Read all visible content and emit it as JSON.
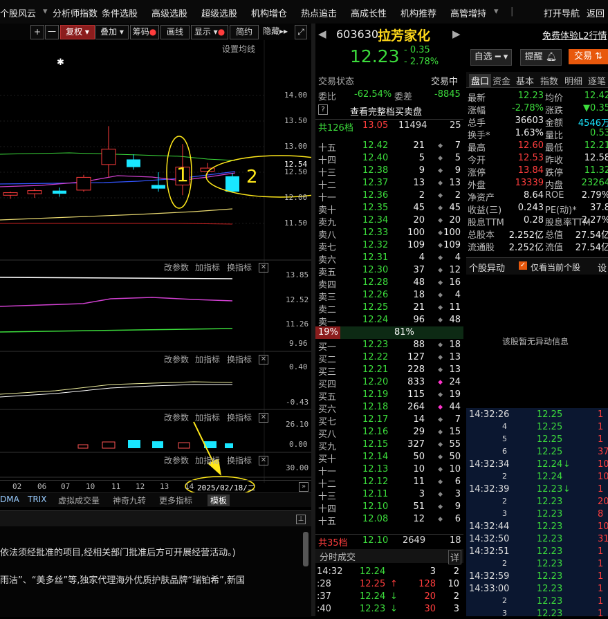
{
  "top_menu": {
    "items": [
      "个股风云",
      "分析师指数",
      "条件选股",
      "高级选股",
      "超级选股",
      "机构增仓",
      "热点追击",
      "高成长性",
      "机构推荐",
      "高管增持"
    ],
    "right_items": [
      "打开导航",
      "返回"
    ]
  },
  "toolbar": {
    "plus": "+",
    "minus": "一",
    "fuquan": "复权",
    "diejia": "叠加",
    "chouma": "筹码",
    "huaxian": "画线",
    "xianshi": "显示",
    "jianyue": "简约",
    "yincang": "隐藏",
    "ma_setting": "设置均线"
  },
  "kline": {
    "y_ticks": [
      "14.00",
      "13.50",
      "13.00",
      "12.54",
      "12.50",
      "12.00",
      "11.50"
    ],
    "annot1": "1",
    "annot2": "2",
    "star": "✱",
    "candles": [
      {
        "o": 12.05,
        "h": 12.12,
        "l": 11.98,
        "c": 12.1
      },
      {
        "o": 12.08,
        "h": 12.18,
        "l": 12.0,
        "c": 12.14
      },
      {
        "o": 12.14,
        "h": 12.2,
        "l": 12.02,
        "c": 12.08
      },
      {
        "o": 12.15,
        "h": 12.45,
        "l": 12.12,
        "c": 12.4
      },
      {
        "o": 12.65,
        "h": 13.4,
        "l": 12.4,
        "c": 12.95
      },
      {
        "o": 12.75,
        "h": 12.85,
        "l": 12.55,
        "c": 12.6
      },
      {
        "o": 12.25,
        "h": 12.5,
        "l": 12.12,
        "c": 12.18
      },
      {
        "o": 12.25,
        "h": 13.05,
        "l": 12.05,
        "c": 12.6
      },
      {
        "o": 12.52,
        "h": 12.68,
        "l": 12.45,
        "c": 12.58
      },
      {
        "o": 12.42,
        "h": 12.48,
        "l": 12.1,
        "c": 12.12
      }
    ]
  },
  "panel2": {
    "ctl": [
      "改参数",
      "加指标",
      "换指标"
    ],
    "y_ticks": [
      "13.85",
      "12.52",
      "11.26",
      "9.96"
    ]
  },
  "panel3": {
    "ctl": [
      "改参数",
      "加指标",
      "换指标"
    ],
    "y_ticks": [
      "0.40",
      "-0.43"
    ]
  },
  "panel4": {
    "ctl": [
      "改参数",
      "加指标",
      "换指标"
    ],
    "y_ticks": [
      "26.10",
      "0.00"
    ]
  },
  "panel5": {
    "ctl": [
      "改参数",
      "加指标",
      "换指标"
    ],
    "y_ticks": [
      "30.00"
    ]
  },
  "dates": [
    "02",
    "06",
    "07",
    "10",
    "11",
    "12",
    "13",
    "14"
  ],
  "date_box": "2025/02/18/二",
  "indicator_tabs": [
    "DMA",
    "TRIX",
    "虚拟成交量",
    "神奇九转",
    "更多指标",
    "模板"
  ],
  "bottom_text": [
    "依法须经批准的项目,经相关部门批准后方可开展经营活动。)",
    "雨洁”、“美多丝”等,独家代理海外优质护肤品牌“瑞铂希”,新国"
  ],
  "stock": {
    "code": "603630",
    "name": "拉芳家化",
    "price": "12.23",
    "change": "- 0.35",
    "pct": "- 2.78%",
    "free_l2": "免费体验L2行情",
    "zixuan": "自选",
    "tixing": "提醒",
    "jiaoyi": "交易"
  },
  "order_book": {
    "status_label": "交易状态",
    "status": "交易中",
    "weibi_label": "委比",
    "weibi": "-62.54%",
    "weicha_label": "委差",
    "weicha": "-8845",
    "full_book": "查看完整档买卖盘",
    "total_sell_label": "共126档",
    "total_sell_price": "13.05",
    "total_sell_vol": "11494",
    "total_sell_cnt": "25",
    "sells": [
      {
        "label": "十五",
        "price": "12.42",
        "vol": "21",
        "cnt": "7"
      },
      {
        "label": "十四",
        "price": "12.40",
        "vol": "5",
        "cnt": "5"
      },
      {
        "label": "十三",
        "price": "12.38",
        "vol": "9",
        "cnt": "9"
      },
      {
        "label": "十二",
        "price": "12.37",
        "vol": "13",
        "cnt": "13"
      },
      {
        "label": "十一",
        "price": "12.36",
        "vol": "2",
        "cnt": "2"
      },
      {
        "label": "卖十",
        "price": "12.35",
        "vol": "45",
        "cnt": "45"
      },
      {
        "label": "卖九",
        "price": "12.34",
        "vol": "20",
        "cnt": "20"
      },
      {
        "label": "卖八",
        "price": "12.33",
        "vol": "100",
        "cnt": "100"
      },
      {
        "label": "卖七",
        "price": "12.32",
        "vol": "109",
        "cnt": "109"
      },
      {
        "label": "卖六",
        "price": "12.31",
        "vol": "4",
        "cnt": "4"
      },
      {
        "label": "卖五",
        "price": "12.30",
        "vol": "37",
        "cnt": "12"
      },
      {
        "label": "卖四",
        "price": "12.28",
        "vol": "48",
        "cnt": "16"
      },
      {
        "label": "卖三",
        "price": "12.26",
        "vol": "18",
        "cnt": "4"
      },
      {
        "label": "卖二",
        "price": "12.25",
        "vol": "21",
        "cnt": "11"
      },
      {
        "label": "卖一",
        "price": "12.24",
        "vol": "96",
        "cnt": "48"
      }
    ],
    "ratio_left": "19%",
    "ratio_right": "81%",
    "buys": [
      {
        "label": "买一",
        "price": "12.23",
        "vol": "88",
        "cnt": "18"
      },
      {
        "label": "买二",
        "price": "12.22",
        "vol": "127",
        "cnt": "13"
      },
      {
        "label": "买三",
        "price": "12.21",
        "vol": "228",
        "cnt": "13"
      },
      {
        "label": "买四",
        "price": "12.20",
        "vol": "833",
        "cnt": "24"
      },
      {
        "label": "买五",
        "price": "12.19",
        "vol": "115",
        "cnt": "19"
      },
      {
        "label": "买六",
        "price": "12.18",
        "vol": "264",
        "cnt": "44"
      },
      {
        "label": "买七",
        "price": "12.17",
        "vol": "14",
        "cnt": "7"
      },
      {
        "label": "买八",
        "price": "12.16",
        "vol": "29",
        "cnt": "15"
      },
      {
        "label": "买九",
        "price": "12.15",
        "vol": "327",
        "cnt": "55"
      },
      {
        "label": "买十",
        "price": "12.14",
        "vol": "50",
        "cnt": "50"
      },
      {
        "label": "十一",
        "price": "12.13",
        "vol": "10",
        "cnt": "10"
      },
      {
        "label": "十二",
        "price": "12.12",
        "vol": "11",
        "cnt": "6"
      },
      {
        "label": "十三",
        "price": "12.11",
        "vol": "3",
        "cnt": "3"
      },
      {
        "label": "十四",
        "price": "12.10",
        "vol": "51",
        "cnt": "9"
      },
      {
        "label": "十五",
        "price": "12.08",
        "vol": "12",
        "cnt": "6"
      }
    ],
    "total_buy_label": "共35档",
    "total_buy_price": "12.10",
    "total_buy_vol": "2649",
    "total_buy_cnt": "18",
    "fenshi_label": "分时成交",
    "detail": "详",
    "fenshi": [
      {
        "t": "14:32",
        "p": "12.24",
        "v": "3",
        "n": "2"
      },
      {
        "t": ":28",
        "p": "12.25",
        "v": "128",
        "n": "10"
      },
      {
        "t": ":37",
        "p": "12.24",
        "v": "20",
        "n": "2"
      },
      {
        "t": ":40",
        "p": "12.23",
        "v": "30",
        "n": "3"
      }
    ]
  },
  "tabs": [
    "盘口",
    "资金",
    "基本",
    "指数",
    "明细",
    "逐笔"
  ],
  "quote": [
    [
      "最新",
      "12.23",
      "均价",
      "12.42"
    ],
    [
      "涨幅",
      "-2.78%",
      "涨跌",
      "▼0.35"
    ],
    [
      "总手",
      "36603",
      "金额",
      "4546万"
    ],
    [
      "换手*",
      "1.63%",
      "量比",
      "0.53"
    ],
    [
      "最高",
      "12.60",
      "最低",
      "12.21"
    ],
    [
      "今开",
      "12.53",
      "昨收",
      "12.58"
    ],
    [
      "涨停",
      "13.84",
      "跌停",
      "11.32"
    ],
    [
      "外盘",
      "13339",
      "内盘",
      "23264"
    ],
    [
      "净资产",
      "8.64",
      "ROE",
      "2.79%"
    ],
    [
      "收益(三)",
      "0.243",
      "PE(动)*",
      "37.8"
    ],
    [
      "股息TTM",
      "0.28",
      "股息率TTM",
      "2.27%"
    ],
    [
      "总股本",
      "2.252亿",
      "总值",
      "27.54亿"
    ],
    [
      "流通股",
      "2.252亿",
      "流值",
      "27.54亿"
    ]
  ],
  "abnormal": {
    "title": "个股异动",
    "only_current": "仅看当前个股",
    "settings": "设",
    "empty": "该股暂无异动信息"
  },
  "ticks": [
    {
      "t": "14:32:26",
      "p": "12.25",
      "v": "1"
    },
    {
      "t": "4",
      "p": "12.25",
      "v": "1"
    },
    {
      "t": "5",
      "p": "12.25",
      "v": "1"
    },
    {
      "t": "6",
      "p": "12.25",
      "v": "37"
    },
    {
      "t": "14:32:34",
      "p": "12.24",
      "v": "10"
    },
    {
      "t": "2",
      "p": "12.24",
      "v": "10"
    },
    {
      "t": "14:32:39",
      "p": "12.23",
      "v": "1"
    },
    {
      "t": "2",
      "p": "12.23",
      "v": "20"
    },
    {
      "t": "3",
      "p": "12.23",
      "v": "8"
    },
    {
      "t": "14:32:44",
      "p": "12.23",
      "v": "10"
    },
    {
      "t": "14:32:50",
      "p": "12.23",
      "v": "31"
    },
    {
      "t": "14:32:51",
      "p": "12.23",
      "v": "1"
    },
    {
      "t": "2",
      "p": "12.23",
      "v": "1"
    },
    {
      "t": "14:32:59",
      "p": "12.23",
      "v": "1"
    },
    {
      "t": "14:33:00",
      "p": "12.23",
      "v": "1"
    },
    {
      "t": "2",
      "p": "12.23",
      "v": "1"
    },
    {
      "t": "3",
      "p": "12.23",
      "v": "1"
    }
  ],
  "colors": {
    "up": "#ff3d3d",
    "down": "#3cdc3c",
    "annot": "#ffe81a",
    "cyan": "#19e6ff",
    "tickbg": "#0b1730"
  }
}
